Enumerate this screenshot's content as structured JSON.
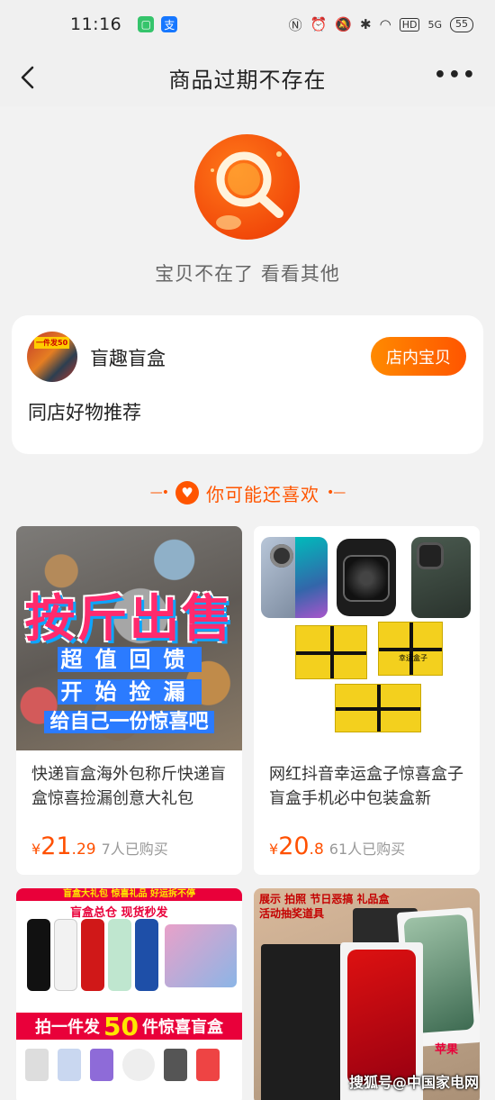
{
  "status_bar": {
    "time": "11:16",
    "apps": [
      "green-app-icon",
      "alipay-icon"
    ],
    "alipay_glyph": "支",
    "hd": "HD",
    "signal": "5G",
    "battery": "55"
  },
  "nav": {
    "title": "商品过期不存在"
  },
  "empty_state": {
    "message": "宝贝不在了 看看其他"
  },
  "shop": {
    "avatar_tag": "一件发50",
    "name": "盲趣盲盒",
    "button_label": "店内宝贝",
    "subtitle": "同店好物推荐"
  },
  "section": {
    "title": "你可能还喜欢",
    "left_deco": "—•",
    "right_deco": "•—"
  },
  "colors": {
    "accent": "#ff5500",
    "price": "#ff5000",
    "background": "#f2f2f2"
  },
  "products": [
    {
      "image_text": {
        "headline": "按斤出售",
        "line1": "超值回馈",
        "line2": "开始捡漏",
        "line3": "给自己一份惊喜吧"
      },
      "title": "快递盲盒海外包称斤快递盲盒惊喜捡漏创意大礼包",
      "price_symbol": "¥",
      "price_int": "21",
      "price_dec": ".29",
      "sold": "7人已购买"
    },
    {
      "image_text": {
        "box_label": "幸运盒子"
      },
      "title": "网红抖音幸运盒子惊喜盒子盲盒手机必中包装盒新",
      "price_symbol": "¥",
      "price_int": "20",
      "price_dec": ".8",
      "sold": "61人已购买"
    },
    {
      "image_text": {
        "strip": "盲盒大礼包 惊喜礼品 好运拆不停",
        "sub": "盲盒总仓 现货秒发",
        "promo_pre": "拍一件发",
        "promo_num": "50",
        "promo_post": "件惊喜盲盒"
      }
    },
    {
      "image_text": {
        "top": "展示 拍照 节日恶搞 礼品盒",
        "top2": "活动抽奖道具",
        "brand": "苹果"
      }
    }
  ],
  "watermark": "搜狐号@中国家电网"
}
